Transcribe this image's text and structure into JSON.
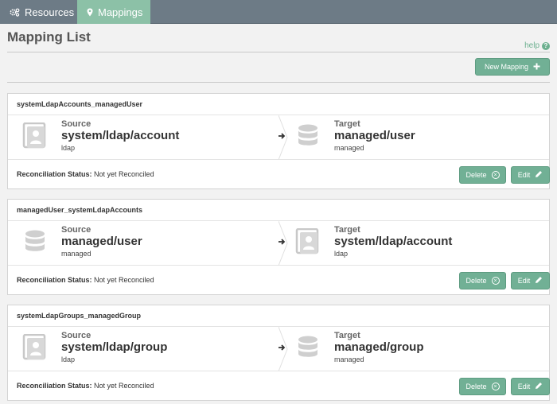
{
  "nav": {
    "tabs": [
      {
        "label": "Resources",
        "icon": "gears-icon",
        "active": false
      },
      {
        "label": "Mappings",
        "icon": "map-marker-icon",
        "active": true
      }
    ]
  },
  "page": {
    "title": "Mapping List",
    "help_label": "help",
    "new_mapping_label": "New Mapping"
  },
  "colors": {
    "accent": "#71b095",
    "nav_bg": "#6d7b86",
    "active_tab": "#8cc1a7",
    "link": "#6cb08f"
  },
  "mappings": [
    {
      "name": "systemLdapAccounts_managedUser",
      "source": {
        "label": "Source",
        "value": "system/ldap/account",
        "sub": "ldap",
        "icon": "account-card-icon"
      },
      "target": {
        "label": "Target",
        "value": "managed/user",
        "sub": "managed",
        "icon": "database-icon"
      },
      "status_label": "Reconciliation Status:",
      "status_value": "Not yet Reconciled",
      "delete_label": "Delete",
      "edit_label": "Edit"
    },
    {
      "name": "managedUser_systemLdapAccounts",
      "source": {
        "label": "Source",
        "value": "managed/user",
        "sub": "managed",
        "icon": "database-icon"
      },
      "target": {
        "label": "Target",
        "value": "system/ldap/account",
        "sub": "ldap",
        "icon": "account-card-icon"
      },
      "status_label": "Reconciliation Status:",
      "status_value": "Not yet Reconciled",
      "delete_label": "Delete",
      "edit_label": "Edit"
    },
    {
      "name": "systemLdapGroups_managedGroup",
      "source": {
        "label": "Source",
        "value": "system/ldap/group",
        "sub": "ldap",
        "icon": "account-card-icon"
      },
      "target": {
        "label": "Target",
        "value": "managed/group",
        "sub": "managed",
        "icon": "database-icon"
      },
      "status_label": "Reconciliation Status:",
      "status_value": "Not yet Reconciled",
      "delete_label": "Delete",
      "edit_label": "Edit"
    }
  ]
}
